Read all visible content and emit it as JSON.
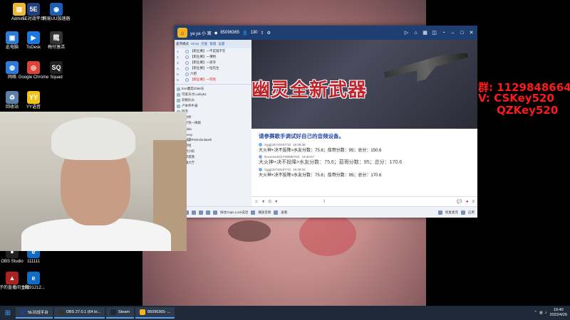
{
  "desktop_icons": [
    {
      "label": "Admin...",
      "color": "#e8b838",
      "glyph": "▤"
    },
    {
      "label": "5E对战平台",
      "color": "#233e7a",
      "glyph": "5E"
    },
    {
      "label": "网易UU加速器",
      "color": "#1a5fb4",
      "glyph": "◉"
    },
    {
      "label": "此电脑",
      "color": "#2f7ad6",
      "glyph": "▣"
    },
    {
      "label": "ToDesk",
      "color": "#1a78e0",
      "glyph": "▶"
    },
    {
      "label": "梅付激活",
      "color": "#333333",
      "glyph": "龍"
    },
    {
      "label": "网络",
      "color": "#2f7ad6",
      "glyph": "◍"
    },
    {
      "label": "Google Chrome",
      "color": "#db4437",
      "glyph": "◎"
    },
    {
      "label": "Squad",
      "color": "#222222",
      "glyph": "SQ"
    },
    {
      "label": "回收站",
      "color": "#5a7fa8",
      "glyph": "♻"
    },
    {
      "label": "YY语音",
      "color": "#f2c21a",
      "glyph": "YY"
    },
    {
      "label": "OBS Studio",
      "color": "#222222",
      "glyph": "●"
    },
    {
      "label": "111111",
      "color": "#0f6bc4",
      "glyph": "e"
    },
    {
      "label": "茄子的直播间主题",
      "color": "#aa2222",
      "glyph": "▲"
    },
    {
      "label": "20191212...",
      "color": "#0f6bc4",
      "glyph": "e"
    }
  ],
  "app": {
    "title": "ya ya 小 窝",
    "channel_id": "85096365",
    "online_count": "130",
    "left_panel": {
      "mode": "麦序模式",
      "timer": "02:52",
      "tab1": "控麦",
      "tab2": "管理",
      "tab3": "设置",
      "mic_queue": [
        {
          "num": "1.",
          "text": "【职业赛】一不是喵不在"
        },
        {
          "num": "2.",
          "text": "【职业赛】一薄物"
        },
        {
          "num": "3.",
          "text": "【职业赛】一渡牙"
        },
        {
          "num": "4.",
          "text": "【职业赛】一恒先生"
        },
        {
          "num": "5.",
          "text": "六把"
        },
        {
          "num": "6.",
          "text": "【职业赛】一风扬"
        }
      ],
      "members": [
        "Eve蘑菇2056号",
        "可爱天才Lusky51",
        "双数队长",
        "卢本伟牛逼",
        "阿杰",
        "你你你",
        "墨叶狗一样跑",
        "Faulda",
        "xDonny",
        "川霸霸RiStrolsnlawth",
        "驻营经",
        "税用小妈",
        "怪叔叔我",
        "撞懂大厅"
      ]
    },
    "banner_title": "幽灵全新武器",
    "chat": {
      "notice": "请参赛歌手调试好自己的音频设备。",
      "messages": [
        {
          "user": "Xggj(2674819773)",
          "time": "19:39:38",
          "body": "大火神+决不投降>水友分数：75.6；茄哥分数：95；总分：150.6",
          "big": false
        },
        {
          "user": "linxuesa42(2730868734)",
          "time": "19:39:57",
          "body": "大火神+决不投降>水友分数：75.6；茄哥分数：95；总分：170.6",
          "big": true
        },
        {
          "user": "Xggj(2674819773)",
          "time": "19:39:03",
          "body": "大火神+决不投降>水友分数：75.6；茄哥分数：95；总分：170.6",
          "big": false
        }
      ]
    },
    "bottom_bar": {
      "caps_hint": "按住Caps Lock说话",
      "record": "播放音频",
      "view": "查看",
      "queue_btn": "抢麦麦克",
      "app_center": "应用"
    }
  },
  "overlay": {
    "line1": "群: 1129848664",
    "line2": "V:  CSKey520",
    "line3": "QZKey520"
  },
  "taskbar": {
    "tasks": [
      {
        "label": "5E对战平台",
        "color": "#233e7a"
      },
      {
        "label": "OBS 27.0.1 (64 bi...",
        "color": "#333333"
      },
      {
        "label": "Steam",
        "color": "#1b2838"
      },
      {
        "label": "85096365- ...",
        "color": "#f6b31e"
      }
    ],
    "time": "19:40",
    "date": "2022/4/26"
  }
}
